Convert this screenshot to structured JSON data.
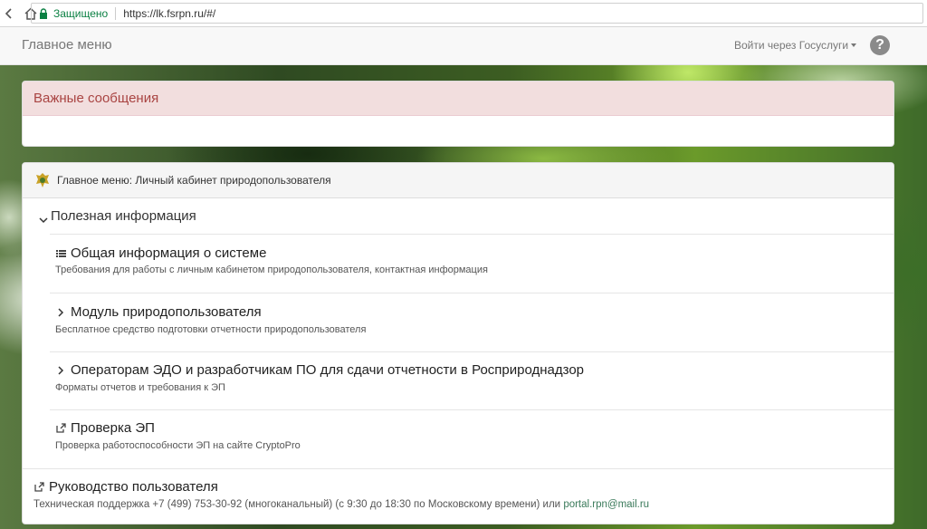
{
  "browser": {
    "secure_label": "Защищено",
    "url": "https://lk.fsrpn.ru/#/"
  },
  "navbar": {
    "title": "Главное меню",
    "login_label": "Войти через Госуслуги",
    "help_symbol": "?"
  },
  "alert": {
    "title": "Важные сообщения"
  },
  "main": {
    "header": "Главное меню: Личный кабинет природопользователя",
    "section_title": "Полезная информация",
    "items": [
      {
        "icon": "list-icon",
        "title": "Общая информация о системе",
        "description": "Требования для работы с личным кабинетом природопользователя, контактная информация"
      },
      {
        "icon": "chevron-right-icon",
        "title": "Модуль природопользователя",
        "description": "Бесплатное средство подготовки отчетности природопользователя"
      },
      {
        "icon": "chevron-right-icon",
        "title": "Операторам ЭДО и разработчикам ПО для сдачи отчетности в Росприроднадзор",
        "description": "Форматы отчетов и требования к ЭП"
      },
      {
        "icon": "external-link-icon",
        "title": "Проверка ЭП",
        "description": "Проверка работоспособности ЭП на сайте CryptoPro"
      }
    ],
    "guide": {
      "title": "Руководство пользователя",
      "support_text": "Техническая поддержка +7 (499) 753-30-92 (многоканальный) (с 9:30 до 18:30 по Московскому времени) или ",
      "support_email": "portal.rpn@mail.ru"
    }
  },
  "colors": {
    "alert_bg": "#f2dede",
    "alert_text": "#a94442",
    "secure_green": "#0b8043",
    "email_link": "#3a7a5a"
  }
}
